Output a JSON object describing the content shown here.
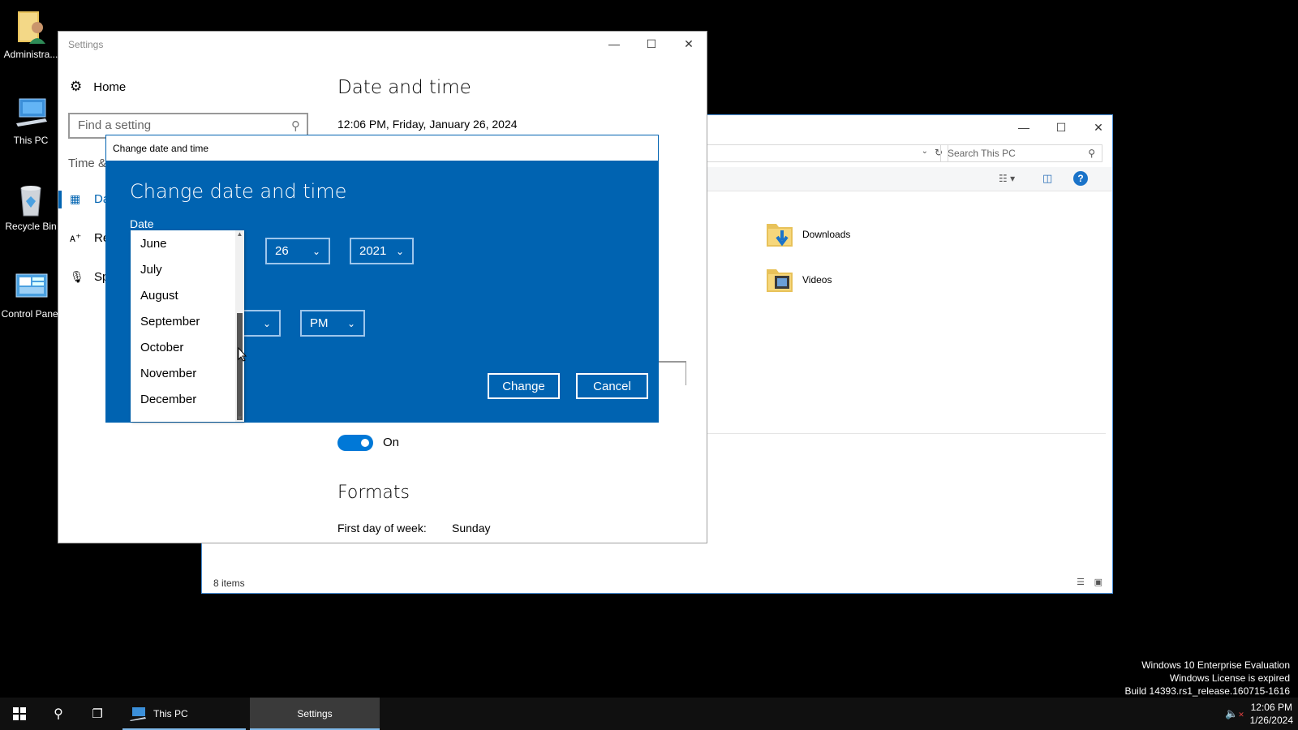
{
  "desktop": {
    "icons": [
      {
        "label": "Administra...",
        "icon": "user-folder-icon"
      },
      {
        "label": "This PC",
        "icon": "computer-icon"
      },
      {
        "label": "Recycle Bin",
        "icon": "recycle-bin-icon"
      },
      {
        "label": "Control Panel",
        "icon": "control-panel-icon"
      }
    ]
  },
  "explorer": {
    "search_placeholder": "Search This PC",
    "folders": [
      {
        "label": "Downloads",
        "icon": "downloads-folder-icon"
      },
      {
        "label": "Videos",
        "icon": "videos-folder-icon"
      }
    ],
    "status": "8 items"
  },
  "settings": {
    "window_title": "Settings",
    "home_label": "Home",
    "search_placeholder": "Find a setting",
    "category_label": "Time &",
    "nav": [
      {
        "label": "Da",
        "icon": "calendar-icon"
      },
      {
        "label": "Re",
        "icon": "region-language-icon"
      },
      {
        "label": "Sp",
        "icon": "microphone-icon"
      }
    ],
    "heading": "Date and time",
    "current_datetime": "12:06 PM, Friday, January 26, 2024",
    "toggle_label": "On",
    "formats_heading": "Formats",
    "first_day_label": "First day of week:",
    "first_day_value": "Sunday"
  },
  "dialog": {
    "window_title": "Change date and time",
    "heading": "Change date and time",
    "date_label": "Date",
    "day": "26",
    "year": "2021",
    "ampm": "PM",
    "change_label": "Change",
    "cancel_label": "Cancel",
    "months": [
      "June",
      "July",
      "August",
      "September",
      "October",
      "November",
      "December"
    ]
  },
  "watermark": {
    "line1": "Windows 10 Enterprise Evaluation",
    "line2": "Windows License is expired",
    "line3": "Build 14393.rs1_release.160715-1616"
  },
  "taskbar": {
    "this_pc": "This PC",
    "settings": "Settings",
    "time": "12:06 PM",
    "date": "1/26/2024"
  },
  "colors": {
    "accent": "#0063b1",
    "toggle_on": "#0078d7"
  }
}
